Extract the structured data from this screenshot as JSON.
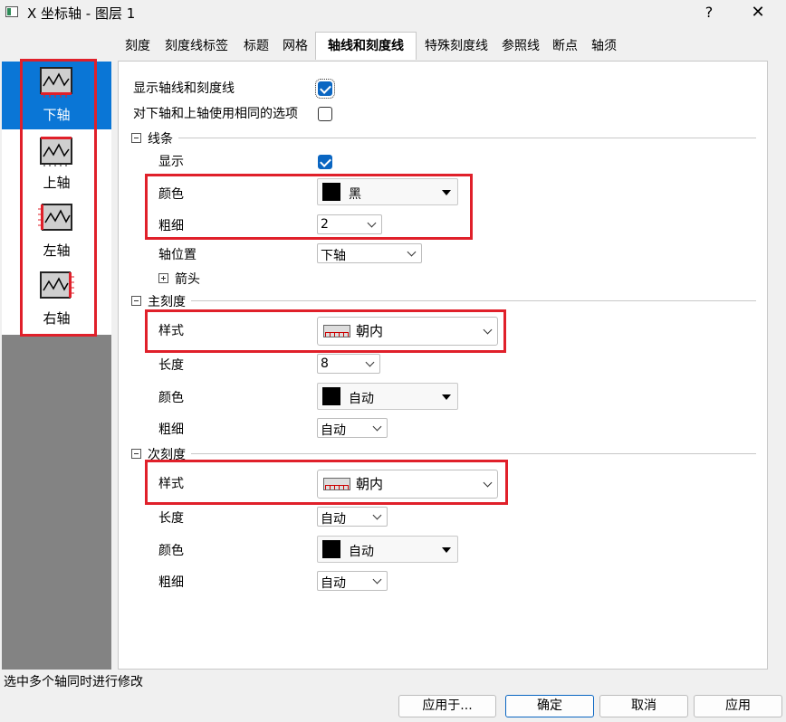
{
  "window": {
    "title": "X 坐标轴 - 图层 1",
    "help_glyph": "?",
    "close_glyph": "✕"
  },
  "tabs": [
    "刻度",
    "刻度线标签",
    "标题",
    "网格",
    "轴线和刻度线",
    "特殊刻度线",
    "参照线",
    "断点",
    "轴须"
  ],
  "active_tab": "轴线和刻度线",
  "axes": [
    {
      "label": "下轴",
      "icon": "bottom-axis-icon",
      "selected": true
    },
    {
      "label": "上轴",
      "icon": "top-axis-icon",
      "selected": false
    },
    {
      "label": "左轴",
      "icon": "left-axis-icon",
      "selected": false
    },
    {
      "label": "右轴",
      "icon": "right-axis-icon",
      "selected": false
    }
  ],
  "options": {
    "show_axis_label": "显示轴线和刻度线",
    "show_axis_checked": true,
    "same_options_label": "对下轴和上轴使用相同的选项",
    "same_options_checked": false
  },
  "line": {
    "section_title": "线条",
    "show_label": "显示",
    "show_checked": true,
    "color_label": "颜色",
    "color_value": "黑",
    "thickness_label": "粗细",
    "thickness_value": "2",
    "axis_pos_label": "轴位置",
    "axis_pos_value": "下轴",
    "arrow_label": "箭头"
  },
  "major": {
    "section_title": "主刻度",
    "style_label": "样式",
    "style_value": "朝内",
    "length_label": "长度",
    "length_value": "8",
    "color_label": "颜色",
    "color_value": "自动",
    "thickness_label": "粗细",
    "thickness_value": "自动"
  },
  "minor": {
    "section_title": "次刻度",
    "style_label": "样式",
    "style_value": "朝内",
    "length_label": "长度",
    "length_value": "自动",
    "color_label": "颜色",
    "color_value": "自动",
    "thickness_label": "粗细",
    "thickness_value": "自动"
  },
  "status": "选中多个轴同时进行修改",
  "buttons": {
    "apply_to": "应用于...",
    "ok": "确定",
    "cancel": "取消",
    "apply": "应用"
  },
  "colors": {
    "accent": "#0a76d6",
    "highlight_box": "#e0202a",
    "panel_gray": "#838383"
  }
}
